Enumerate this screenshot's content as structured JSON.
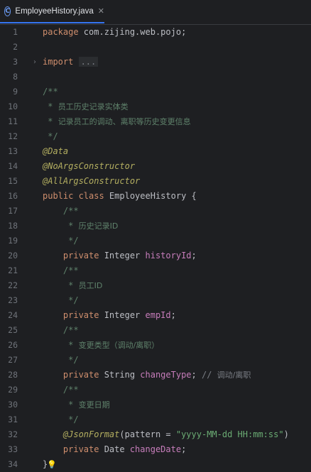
{
  "tab": {
    "label": "EmployeeHistory.java",
    "icon": "class-icon",
    "close": "✕"
  },
  "lines": [
    {
      "n": "1",
      "parts": [
        [
          "kw",
          "package "
        ],
        [
          "",
          "com.zijing.web.pojo;"
        ]
      ]
    },
    {
      "n": "2",
      "parts": []
    },
    {
      "n": "3",
      "fold": true,
      "parts": [
        [
          "kw",
          "import "
        ],
        [
          "fold-text",
          "..."
        ]
      ]
    },
    {
      "n": "8",
      "parts": []
    },
    {
      "n": "9",
      "parts": [
        [
          "doc",
          "/**"
        ]
      ]
    },
    {
      "n": "10",
      "parts": [
        [
          "doc",
          " * "
        ],
        [
          "doc doc-cn",
          "员工历史记录实体类"
        ]
      ]
    },
    {
      "n": "11",
      "parts": [
        [
          "doc",
          " * "
        ],
        [
          "doc doc-cn",
          "记录员工的调动、离职等历史变更信息"
        ]
      ]
    },
    {
      "n": "12",
      "parts": [
        [
          "doc",
          " */"
        ]
      ]
    },
    {
      "n": "13",
      "parts": [
        [
          "ann",
          "@Data"
        ]
      ]
    },
    {
      "n": "14",
      "parts": [
        [
          "ann",
          "@NoArgsConstructor"
        ]
      ]
    },
    {
      "n": "15",
      "parts": [
        [
          "ann",
          "@AllArgsConstructor"
        ]
      ]
    },
    {
      "n": "16",
      "parts": [
        [
          "kw",
          "public class "
        ],
        [
          "cls",
          "EmployeeHistory "
        ],
        [
          "",
          "{"
        ]
      ]
    },
    {
      "n": "17",
      "parts": [
        [
          "doc",
          "    /**"
        ]
      ]
    },
    {
      "n": "18",
      "parts": [
        [
          "doc",
          "     * "
        ],
        [
          "doc doc-cn",
          "历史记录ID"
        ]
      ]
    },
    {
      "n": "19",
      "parts": [
        [
          "doc",
          "     */"
        ]
      ]
    },
    {
      "n": "20",
      "parts": [
        [
          "kw",
          "    private "
        ],
        [
          "",
          "Integer "
        ],
        [
          "field",
          "historyId"
        ],
        [
          "",
          ";"
        ]
      ]
    },
    {
      "n": "21",
      "parts": [
        [
          "doc",
          "    /**"
        ]
      ]
    },
    {
      "n": "22",
      "parts": [
        [
          "doc",
          "     * "
        ],
        [
          "doc doc-cn",
          "员工ID"
        ]
      ]
    },
    {
      "n": "23",
      "parts": [
        [
          "doc",
          "     */"
        ]
      ]
    },
    {
      "n": "24",
      "parts": [
        [
          "kw",
          "    private "
        ],
        [
          "",
          "Integer "
        ],
        [
          "field",
          "empId"
        ],
        [
          "",
          ";"
        ]
      ]
    },
    {
      "n": "25",
      "parts": [
        [
          "doc",
          "    /**"
        ]
      ]
    },
    {
      "n": "26",
      "parts": [
        [
          "doc",
          "     * "
        ],
        [
          "doc doc-cn",
          "变更类型（调动/离职）"
        ]
      ]
    },
    {
      "n": "27",
      "parts": [
        [
          "doc",
          "     */"
        ]
      ]
    },
    {
      "n": "28",
      "parts": [
        [
          "kw",
          "    private "
        ],
        [
          "",
          "String "
        ],
        [
          "field",
          "changeType"
        ],
        [
          "",
          "; "
        ],
        [
          "cmt",
          "// "
        ],
        [
          "cmt cmt-cn",
          "调动/离职"
        ]
      ]
    },
    {
      "n": "29",
      "parts": [
        [
          "doc",
          "    /**"
        ]
      ]
    },
    {
      "n": "30",
      "parts": [
        [
          "doc",
          "     * "
        ],
        [
          "doc doc-cn",
          "变更日期"
        ]
      ]
    },
    {
      "n": "31",
      "parts": [
        [
          "doc",
          "     */"
        ]
      ]
    },
    {
      "n": "32",
      "parts": [
        [
          "ann",
          "    @JsonFormat"
        ],
        [
          "",
          "("
        ],
        [
          "",
          "pattern = "
        ],
        [
          "str",
          "\"yyyy-MM-dd HH:mm:ss\""
        ],
        [
          "",
          ")"
        ]
      ]
    },
    {
      "n": "33",
      "parts": [
        [
          "kw",
          "    private "
        ],
        [
          "",
          "Date "
        ],
        [
          "field",
          "changeDate"
        ],
        [
          "",
          ";"
        ]
      ]
    },
    {
      "n": "34",
      "bulb": true,
      "parts": [
        [
          "",
          "}"
        ]
      ]
    }
  ]
}
